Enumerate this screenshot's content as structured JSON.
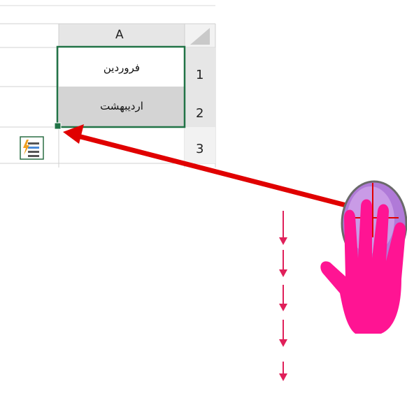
{
  "spreadsheet": {
    "column_header": "A",
    "rows": [
      {
        "row_number": "1",
        "cell_a": "فروردین"
      },
      {
        "row_number": "2",
        "cell_a": "اردیبهشت"
      },
      {
        "row_number": "3",
        "cell_a": ""
      }
    ]
  },
  "icons": {
    "flash_fill_options": "flash-fill-options-icon",
    "fill_handle": "fill-handle",
    "mouse_hand": "mouse-hand-icon",
    "drag_arrow": "drag-arrow",
    "down_arrows": "down-arrow-icon"
  },
  "colors": {
    "selection_border": "#217346",
    "arrow_red": "#e00000",
    "hand_pink": "#ff1493",
    "mouse_purple": "#b07ad8",
    "down_arrow": "#e0205a",
    "header_bg": "#e6e6e6",
    "selected_cell_bg": "#d4d4d4"
  }
}
